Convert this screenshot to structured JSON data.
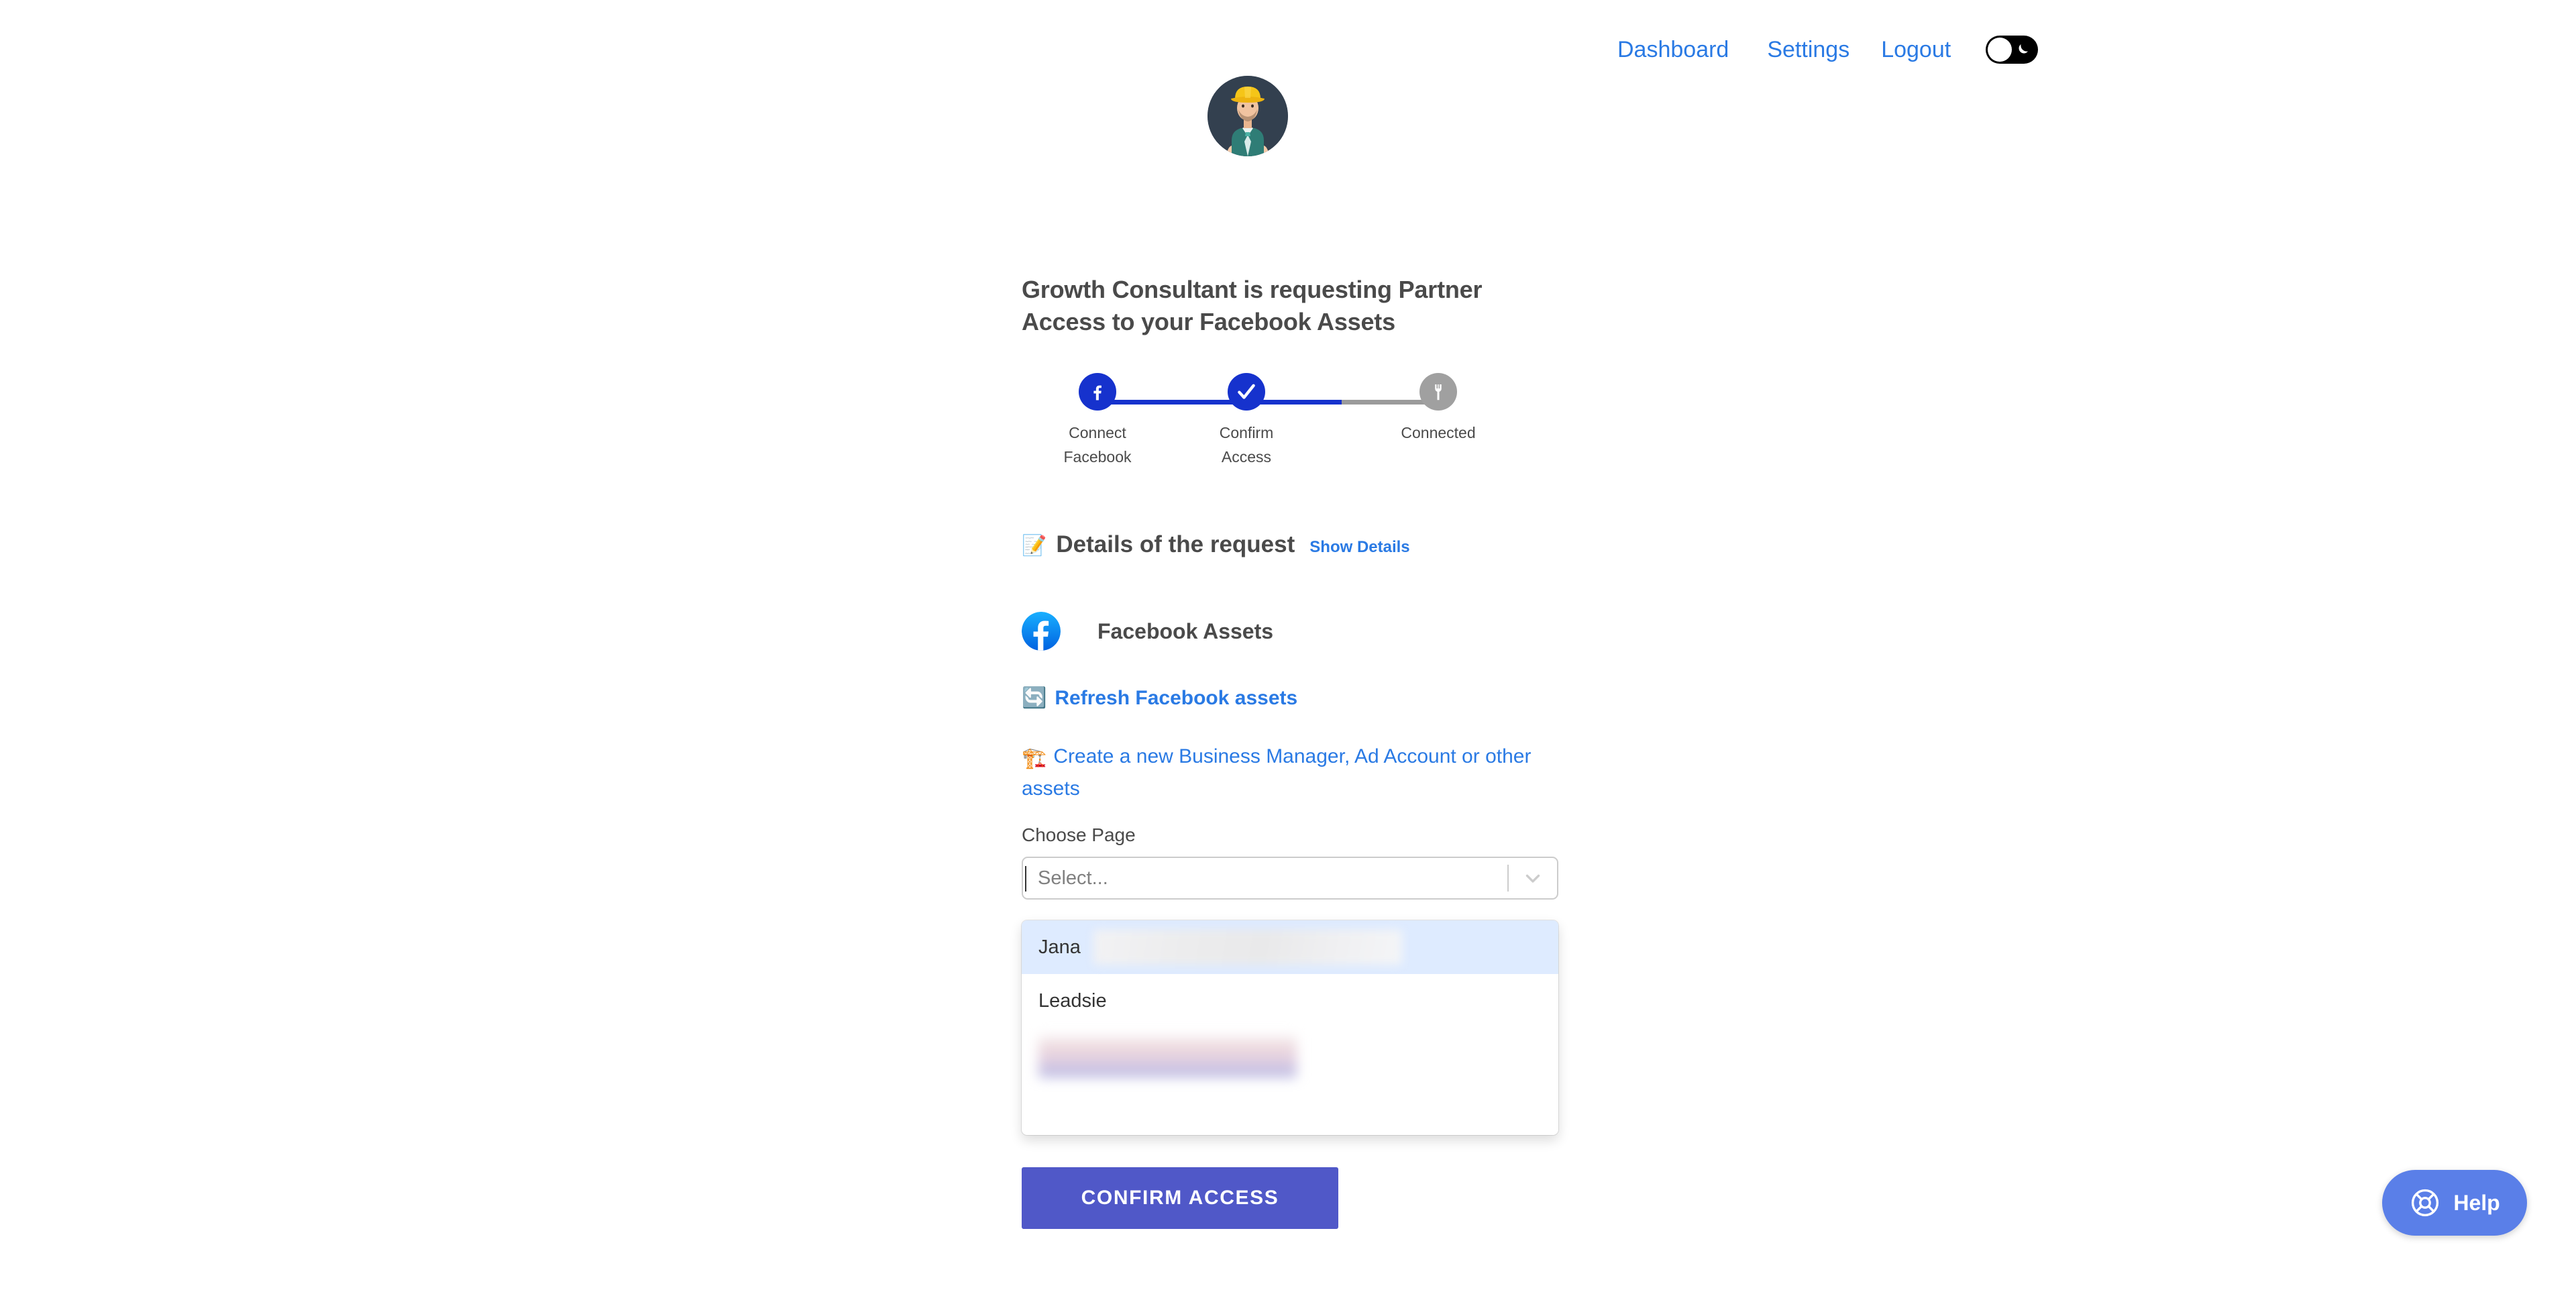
{
  "nav": {
    "links": [
      {
        "label": "Dashboard",
        "name": "nav-link-dashboard"
      },
      {
        "label": "Settings",
        "name": "nav-link-settings"
      },
      {
        "label": "Logout",
        "name": "nav-link-logout"
      }
    ],
    "dark_mode_toggle": {
      "state": "off",
      "icon": "moon-icon"
    }
  },
  "avatar": {
    "alt": "Consultant avatar with hard hat",
    "background_color": "#33404f"
  },
  "headline": "Growth Consultant is requesting Partner Access to your Facebook Assets",
  "stepper": {
    "steps": [
      {
        "label": "Connect\nFacebook",
        "icon": "facebook-icon",
        "state": "complete",
        "color": "#1632cd"
      },
      {
        "label": "Confirm\nAccess",
        "icon": "check-icon",
        "state": "current",
        "color": "#1632cd"
      },
      {
        "label": "Connected",
        "icon": "plug-icon",
        "state": "pending",
        "color": "#a0a0a0"
      }
    ],
    "progress_percent": 72,
    "line_active_color": "#1632cd",
    "line_inactive_color": "#9b9b9b"
  },
  "details": {
    "icon": "📝",
    "title": "Details of the request",
    "show_details_label": "Show Details",
    "link_color": "#2a7ae4"
  },
  "facebook_assets": {
    "section_title": "Facebook Assets",
    "logo_icon": "facebook-icon",
    "refresh": {
      "icon": "🔄",
      "label": "Refresh Facebook assets"
    },
    "create": {
      "icon": "🏗️",
      "label": "Create a new Business Manager, Ad Account or other assets"
    }
  },
  "select": {
    "label": "Choose Page",
    "placeholder": "Select...",
    "value": "",
    "arrow_icon": "chevron-down-icon",
    "menu_open": true,
    "options": [
      {
        "label": "Jana",
        "focused": true,
        "redacted_suffix": true
      },
      {
        "label": "Leadsie",
        "focused": false,
        "redacted_suffix": false
      },
      {
        "label": "",
        "focused": false,
        "redacted_suffix": true
      }
    ],
    "focus_background": "#deebff"
  },
  "confirm_button": {
    "label": "CONFIRM ACCESS",
    "color": "#5058c8"
  },
  "help_widget": {
    "label": "Help",
    "icon": "lifebuoy-icon",
    "color": "#5a7fe8"
  }
}
